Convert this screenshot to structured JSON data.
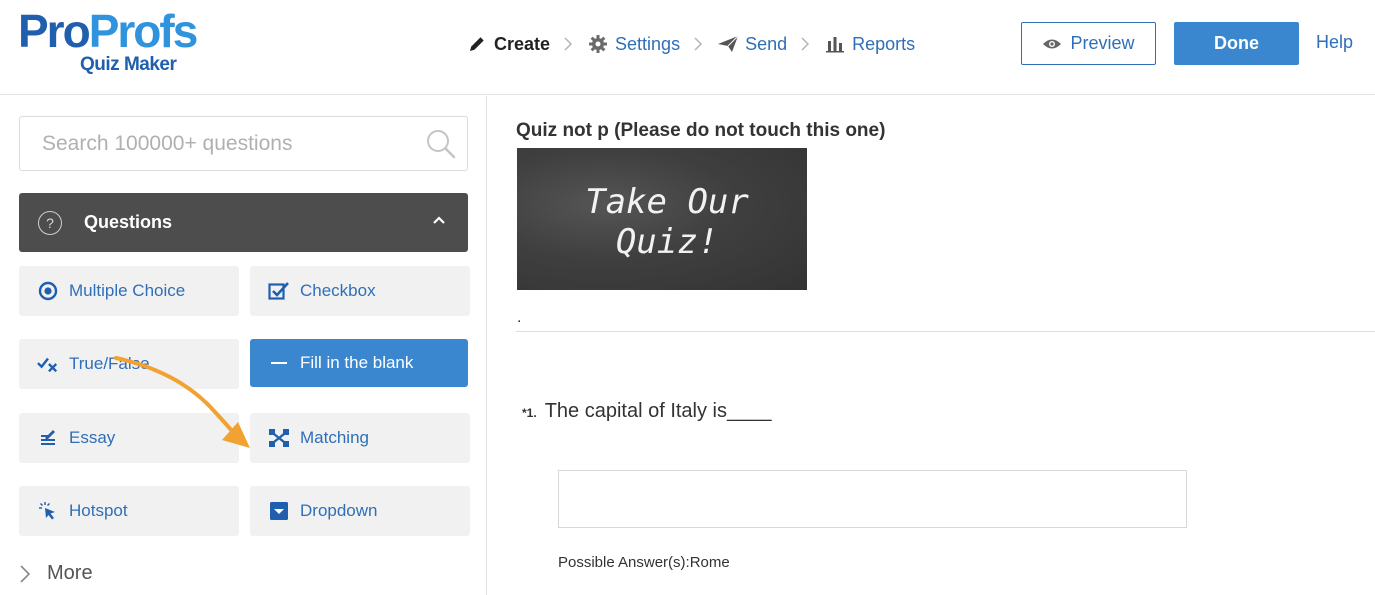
{
  "logo": {
    "word_part1": "Pro",
    "word_part2": "Profs",
    "subtitle": "Quiz Maker"
  },
  "nav": {
    "steps": [
      {
        "label": "Create",
        "icon": "pencil-icon",
        "active": true
      },
      {
        "label": "Settings",
        "icon": "gear-icon",
        "active": false
      },
      {
        "label": "Send",
        "icon": "paper-plane-icon",
        "active": false
      },
      {
        "label": "Reports",
        "icon": "bar-chart-icon",
        "active": false
      }
    ],
    "preview_label": "Preview",
    "done_label": "Done",
    "help_label": "Help"
  },
  "sidebar": {
    "search_placeholder": "Search 100000+ questions",
    "section_title": "Questions",
    "question_types": [
      {
        "label": "Multiple Choice",
        "icon": "radio-target-icon",
        "active": false
      },
      {
        "label": "Checkbox",
        "icon": "checkbox-icon",
        "active": false
      },
      {
        "label": "True/False",
        "icon": "check-cross-icon",
        "active": false
      },
      {
        "label": "Fill in the blank",
        "icon": "dash-icon",
        "active": true
      },
      {
        "label": "Essay",
        "icon": "essay-icon",
        "active": false
      },
      {
        "label": "Matching",
        "icon": "matching-icon",
        "active": false
      },
      {
        "label": "Hotspot",
        "icon": "cursor-click-icon",
        "active": false
      },
      {
        "label": "Dropdown",
        "icon": "dropdown-icon",
        "active": false
      }
    ],
    "more_label": "More"
  },
  "main": {
    "quiz_title": "Quiz not p (Please do not touch this one)",
    "banner_text": "Take Our Quiz!",
    "description": ".",
    "question": {
      "number": "*1.",
      "text": "The capital of Italy is____",
      "answer_value": "",
      "possible_answers": "Possible Answer(s):Rome"
    }
  },
  "colors": {
    "brand_dark_blue": "#1f5fae",
    "brand_light_blue": "#2f93dd",
    "link_blue": "#2f6fb7",
    "accent_blue": "#3a87d0",
    "section_header": "#4d4d4d",
    "annotation_arrow": "#f2a230"
  }
}
